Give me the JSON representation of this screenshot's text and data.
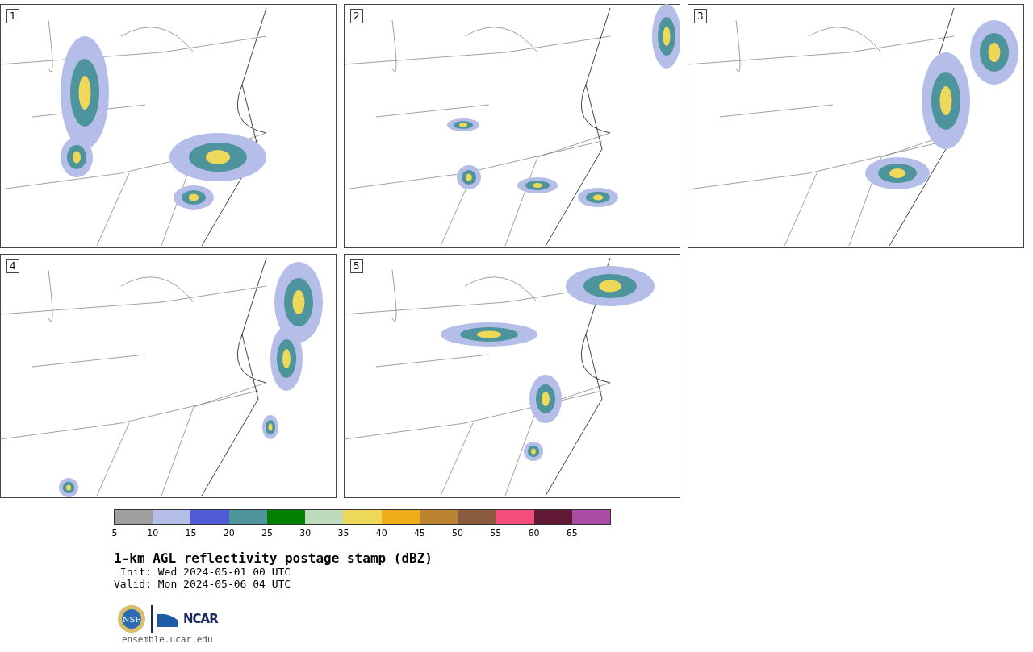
{
  "panels": [
    {
      "label": "1"
    },
    {
      "label": "2"
    },
    {
      "label": "3"
    },
    {
      "label": "4"
    },
    {
      "label": "5"
    }
  ],
  "colorbar": [
    {
      "label": "5",
      "color": "#a0a0a0"
    },
    {
      "label": "10",
      "color": "#b4bee9"
    },
    {
      "label": "15",
      "color": "#515bd6"
    },
    {
      "label": "20",
      "color": "#4e949c"
    },
    {
      "label": "25",
      "color": "#008200"
    },
    {
      "label": "30",
      "color": "#bedcbc"
    },
    {
      "label": "35",
      "color": "#eed85a"
    },
    {
      "label": "40",
      "color": "#efac18"
    },
    {
      "label": "45",
      "color": "#bb8230"
    },
    {
      "label": "50",
      "color": "#8a5a3e"
    },
    {
      "label": "55",
      "color": "#f44e7c"
    },
    {
      "label": "60",
      "color": "#601834"
    },
    {
      "label": "65",
      "color": "#ab4ba4"
    }
  ],
  "title": "1-km AGL reflectivity postage stamp (dBZ)",
  "init": " Init: Wed 2024-05-01 00 UTC",
  "valid": "Valid: Mon 2024-05-06 04 UTC",
  "logo": {
    "seal": "NSF",
    "wordmark": "NCAR"
  },
  "site": "ensemble.ucar.edu"
}
